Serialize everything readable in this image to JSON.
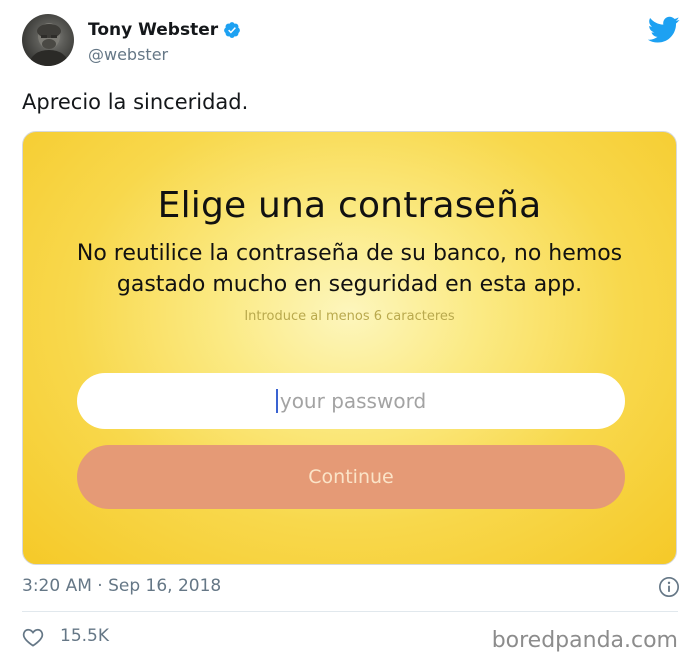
{
  "author": {
    "display_name": "Tony Webster",
    "handle": "@webster",
    "verified": true
  },
  "icons": {
    "avatar": "avatar-photo",
    "verified": "verified-badge-icon",
    "brand": "twitter-bird-icon",
    "info": "info-icon",
    "like": "heart-icon"
  },
  "tweet": {
    "text": "Aprecio la sinceridad.",
    "timestamp": "3:20 AM · Sep 16, 2018",
    "likes": "15.5K"
  },
  "card": {
    "title": "Elige una contraseña",
    "subtitle": "No reutilice la contraseña de su banco, no hemos gastado mucho en seguridad en esta app.",
    "hint": "Introduce al menos 6 caracteres",
    "password_placeholder": "your password",
    "continue_label": "Continue"
  },
  "watermark": "boredpanda.com",
  "colors": {
    "twitter_blue": "#1da1f2",
    "card_yellow": "#f8d84c",
    "button_salmon": "#e59a76"
  }
}
